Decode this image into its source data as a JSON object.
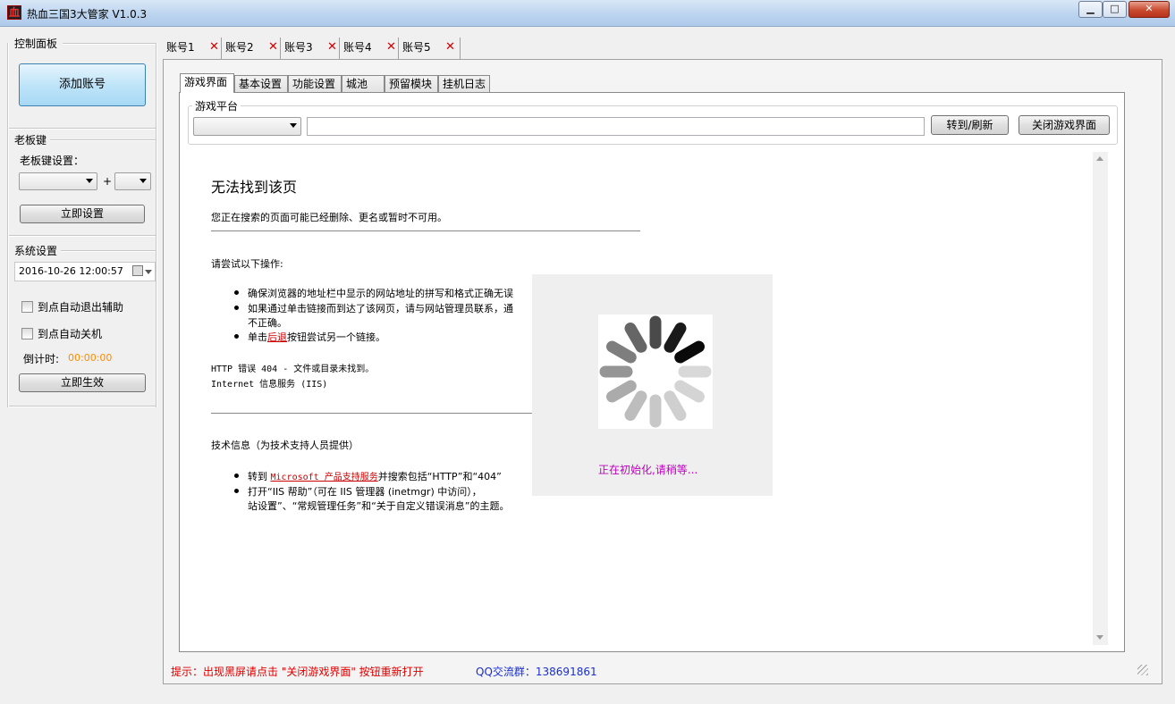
{
  "window": {
    "title": "热血三国3大管家 V1.0.3",
    "minimize": "▁",
    "maximize": "□",
    "close": "✕"
  },
  "left": {
    "control_panel": {
      "title": "控制面板",
      "add_account": "添加账号"
    },
    "boss_key": {
      "title": "老板键",
      "setting_label": "老板键设置：",
      "plus": "+",
      "apply": "立即设置"
    },
    "system": {
      "title": "系统设置",
      "datetime": "2016-10-26 12:00:57",
      "auto_exit_label": "到点自动退出辅助",
      "auto_shutdown_label": "到点自动关机",
      "countdown_label": "倒计时:",
      "countdown_value": "00:00:00",
      "apply": "立即生效"
    }
  },
  "account_tabs": [
    {
      "label": "账号1",
      "close": "✕"
    },
    {
      "label": "账号2",
      "close": "✕"
    },
    {
      "label": "账号3",
      "close": "✕"
    },
    {
      "label": "账号4",
      "close": "✕"
    },
    {
      "label": "账号5",
      "close": "✕"
    }
  ],
  "inner_tabs": [
    "游戏界面",
    "基本设置",
    "功能设置",
    "城池",
    "预留模块",
    "挂机日志"
  ],
  "platform": {
    "title": "游戏平台",
    "selected": "",
    "url": "",
    "goto_refresh": "转到/刷新",
    "close_game": "关闭游戏界面"
  },
  "webpage": {
    "heading": "无法找到该页",
    "desc": "您正在搜索的页面可能已经删除、更名或暂时不可用。",
    "try_title": "请尝试以下操作:",
    "bullet1": "确保浏览器的地址栏中显示的网站地址的拼写和格式正确无误",
    "bullet2a": "如果通过单击链接而到达了该网页，请与网站管理员联系，通",
    "bullet2b": "不正确。",
    "bullet3_pre": "单击",
    "bullet3_link": "后退",
    "bullet3_post": "按钮尝试另一个链接。",
    "error1": "HTTP 错误 404 - 文件或目录未找到。",
    "error2": "Internet 信息服务 (IIS)",
    "tech_title": "技术信息（为技术支持人员提供）",
    "tech1_pre": "转到 ",
    "tech1_link": "Microsoft 产品支持服务",
    "tech1_post": "并搜索包括“HTTP”和“404”",
    "tech2a": "打开“IIS 帮助”（可在 IIS 管理器 (inetmgr) 中访问），",
    "tech2b": "站设置”、“常规管理任务”和“关于自定义错误消息”的主题。"
  },
  "loading": {
    "text": "正在初始化,请稍等..."
  },
  "status": {
    "hint": "提示：出现黑屏请点击 \"关闭游戏界面\" 按钮重新打开",
    "qq": "QQ交流群：138691861"
  },
  "colors": {
    "hint": "#e00000",
    "qq": "#1a2fd0",
    "countdown": "#ff8c00",
    "loading_text": "#c000c0",
    "link": "#c00000"
  }
}
